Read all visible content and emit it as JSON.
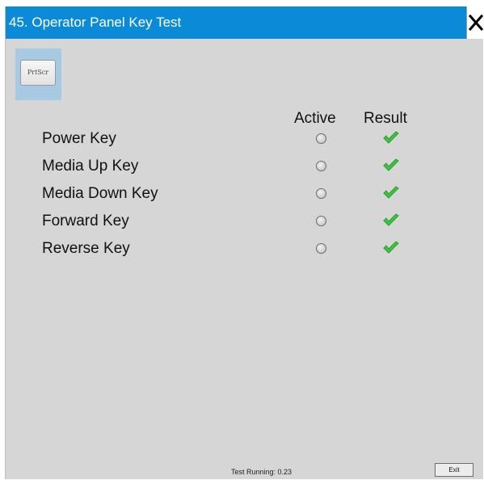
{
  "window": {
    "title": "45. Operator Panel Key Test",
    "close_icon": "close-x-icon"
  },
  "toolbar": {
    "prtscr_label": "PrtScr"
  },
  "table": {
    "columns": [
      "Active",
      "Result"
    ],
    "rows": [
      {
        "key": "Power Key",
        "active": false,
        "result": "pass"
      },
      {
        "key": "Media Up Key",
        "active": false,
        "result": "pass"
      },
      {
        "key": "Media Down Key",
        "active": false,
        "result": "pass"
      },
      {
        "key": "Forward Key",
        "active": false,
        "result": "pass"
      },
      {
        "key": "Reverse Key",
        "active": false,
        "result": "pass"
      }
    ]
  },
  "footer": {
    "status": "Test Running: 0.23",
    "exit_label": "Exit"
  },
  "colors": {
    "titlebar": "#0b8bd7",
    "background": "#d6d6d6",
    "check_green": "#3cc83c"
  }
}
